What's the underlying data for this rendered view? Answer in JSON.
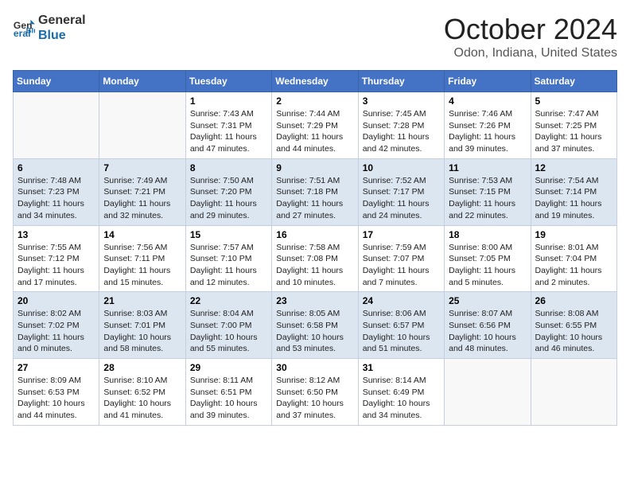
{
  "header": {
    "logo_line1": "General",
    "logo_line2": "Blue",
    "title": "October 2024",
    "subtitle": "Odon, Indiana, United States"
  },
  "days_of_week": [
    "Sunday",
    "Monday",
    "Tuesday",
    "Wednesday",
    "Thursday",
    "Friday",
    "Saturday"
  ],
  "weeks": [
    [
      {
        "day": "",
        "content": ""
      },
      {
        "day": "",
        "content": ""
      },
      {
        "day": "1",
        "content": "Sunrise: 7:43 AM\nSunset: 7:31 PM\nDaylight: 11 hours and 47 minutes."
      },
      {
        "day": "2",
        "content": "Sunrise: 7:44 AM\nSunset: 7:29 PM\nDaylight: 11 hours and 44 minutes."
      },
      {
        "day": "3",
        "content": "Sunrise: 7:45 AM\nSunset: 7:28 PM\nDaylight: 11 hours and 42 minutes."
      },
      {
        "day": "4",
        "content": "Sunrise: 7:46 AM\nSunset: 7:26 PM\nDaylight: 11 hours and 39 minutes."
      },
      {
        "day": "5",
        "content": "Sunrise: 7:47 AM\nSunset: 7:25 PM\nDaylight: 11 hours and 37 minutes."
      }
    ],
    [
      {
        "day": "6",
        "content": "Sunrise: 7:48 AM\nSunset: 7:23 PM\nDaylight: 11 hours and 34 minutes."
      },
      {
        "day": "7",
        "content": "Sunrise: 7:49 AM\nSunset: 7:21 PM\nDaylight: 11 hours and 32 minutes."
      },
      {
        "day": "8",
        "content": "Sunrise: 7:50 AM\nSunset: 7:20 PM\nDaylight: 11 hours and 29 minutes."
      },
      {
        "day": "9",
        "content": "Sunrise: 7:51 AM\nSunset: 7:18 PM\nDaylight: 11 hours and 27 minutes."
      },
      {
        "day": "10",
        "content": "Sunrise: 7:52 AM\nSunset: 7:17 PM\nDaylight: 11 hours and 24 minutes."
      },
      {
        "day": "11",
        "content": "Sunrise: 7:53 AM\nSunset: 7:15 PM\nDaylight: 11 hours and 22 minutes."
      },
      {
        "day": "12",
        "content": "Sunrise: 7:54 AM\nSunset: 7:14 PM\nDaylight: 11 hours and 19 minutes."
      }
    ],
    [
      {
        "day": "13",
        "content": "Sunrise: 7:55 AM\nSunset: 7:12 PM\nDaylight: 11 hours and 17 minutes."
      },
      {
        "day": "14",
        "content": "Sunrise: 7:56 AM\nSunset: 7:11 PM\nDaylight: 11 hours and 15 minutes."
      },
      {
        "day": "15",
        "content": "Sunrise: 7:57 AM\nSunset: 7:10 PM\nDaylight: 11 hours and 12 minutes."
      },
      {
        "day": "16",
        "content": "Sunrise: 7:58 AM\nSunset: 7:08 PM\nDaylight: 11 hours and 10 minutes."
      },
      {
        "day": "17",
        "content": "Sunrise: 7:59 AM\nSunset: 7:07 PM\nDaylight: 11 hours and 7 minutes."
      },
      {
        "day": "18",
        "content": "Sunrise: 8:00 AM\nSunset: 7:05 PM\nDaylight: 11 hours and 5 minutes."
      },
      {
        "day": "19",
        "content": "Sunrise: 8:01 AM\nSunset: 7:04 PM\nDaylight: 11 hours and 2 minutes."
      }
    ],
    [
      {
        "day": "20",
        "content": "Sunrise: 8:02 AM\nSunset: 7:02 PM\nDaylight: 11 hours and 0 minutes."
      },
      {
        "day": "21",
        "content": "Sunrise: 8:03 AM\nSunset: 7:01 PM\nDaylight: 10 hours and 58 minutes."
      },
      {
        "day": "22",
        "content": "Sunrise: 8:04 AM\nSunset: 7:00 PM\nDaylight: 10 hours and 55 minutes."
      },
      {
        "day": "23",
        "content": "Sunrise: 8:05 AM\nSunset: 6:58 PM\nDaylight: 10 hours and 53 minutes."
      },
      {
        "day": "24",
        "content": "Sunrise: 8:06 AM\nSunset: 6:57 PM\nDaylight: 10 hours and 51 minutes."
      },
      {
        "day": "25",
        "content": "Sunrise: 8:07 AM\nSunset: 6:56 PM\nDaylight: 10 hours and 48 minutes."
      },
      {
        "day": "26",
        "content": "Sunrise: 8:08 AM\nSunset: 6:55 PM\nDaylight: 10 hours and 46 minutes."
      }
    ],
    [
      {
        "day": "27",
        "content": "Sunrise: 8:09 AM\nSunset: 6:53 PM\nDaylight: 10 hours and 44 minutes."
      },
      {
        "day": "28",
        "content": "Sunrise: 8:10 AM\nSunset: 6:52 PM\nDaylight: 10 hours and 41 minutes."
      },
      {
        "day": "29",
        "content": "Sunrise: 8:11 AM\nSunset: 6:51 PM\nDaylight: 10 hours and 39 minutes."
      },
      {
        "day": "30",
        "content": "Sunrise: 8:12 AM\nSunset: 6:50 PM\nDaylight: 10 hours and 37 minutes."
      },
      {
        "day": "31",
        "content": "Sunrise: 8:14 AM\nSunset: 6:49 PM\nDaylight: 10 hours and 34 minutes."
      },
      {
        "day": "",
        "content": ""
      },
      {
        "day": "",
        "content": ""
      }
    ]
  ]
}
